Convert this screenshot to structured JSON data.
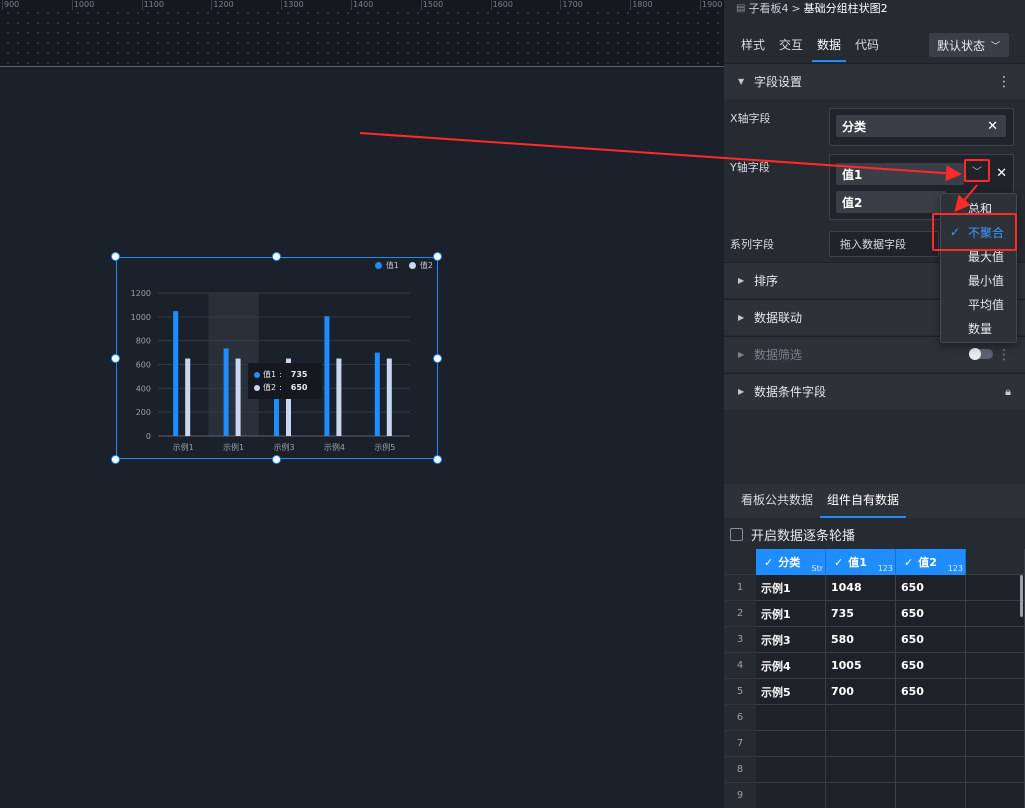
{
  "ruler": {
    "ticks": [
      "900",
      "1000",
      "1100",
      "1200",
      "1300",
      "1400",
      "1500",
      "1600",
      "1700",
      "1800",
      "1900"
    ]
  },
  "chart": {
    "legend": [
      {
        "name": "值1",
        "color": "#1f8cff"
      },
      {
        "name": "值2",
        "color": "#c9d8f0"
      }
    ],
    "tooltip": {
      "rows": [
        {
          "name": "值1",
          "value": "735",
          "color": "#1f8cff"
        },
        {
          "name": "值2",
          "value": "650",
          "color": "#c9d8f0"
        }
      ]
    }
  },
  "chart_data": {
    "type": "bar",
    "categories": [
      "示例1",
      "示例1",
      "示例3",
      "示例4",
      "示例5"
    ],
    "series": [
      {
        "name": "值1",
        "values": [
          1048,
          735,
          580,
          1005,
          700
        ],
        "color": "#1f8cff"
      },
      {
        "name": "值2",
        "values": [
          650,
          650,
          650,
          650,
          650
        ],
        "color": "#c9d8f0"
      }
    ],
    "ylim": [
      0,
      1200
    ],
    "yticks": [
      0,
      200,
      400,
      600,
      800,
      1000,
      1200
    ],
    "grid": true,
    "legend_position": "top-right",
    "highlighted_category_index": 1
  },
  "panel": {
    "breadcrumb": {
      "parent": "子看板4",
      "separator": ">",
      "current": "基础分组柱状图2"
    },
    "tabs": [
      "样式",
      "交互",
      "数据",
      "代码"
    ],
    "active_tab": "数据",
    "state_select": "默认状态",
    "field_section": {
      "title": "字段设置"
    },
    "x_field": {
      "label": "X轴字段",
      "value": "分类"
    },
    "y_field": {
      "label": "Y轴字段",
      "values": [
        "值1",
        "值2"
      ]
    },
    "series_field": {
      "label": "系列字段",
      "placeholder": "拖入数据字段"
    },
    "aggregate_menu": {
      "items": [
        "总和",
        "不聚合",
        "最大值",
        "最小值",
        "平均值",
        "数量"
      ],
      "selected": "不聚合"
    },
    "sections": [
      {
        "title": "排序",
        "dim": false
      },
      {
        "title": "数据联动",
        "dim": false
      },
      {
        "title": "数据筛选",
        "dim": true
      },
      {
        "title": "数据条件字段",
        "dim": false
      }
    ],
    "data_tabs": [
      "看板公共数据",
      "组件自有数据"
    ],
    "active_data_tab": "组件自有数据",
    "carousel_label": "开启数据逐条轮播",
    "table": {
      "columns": [
        {
          "name": "分类",
          "type": "Str"
        },
        {
          "name": "值1",
          "type": "123"
        },
        {
          "name": "值2",
          "type": "123"
        }
      ],
      "rows": [
        [
          "示例1",
          "1048",
          "650"
        ],
        [
          "示例1",
          "735",
          "650"
        ],
        [
          "示例3",
          "580",
          "650"
        ],
        [
          "示例4",
          "1005",
          "650"
        ],
        [
          "示例5",
          "700",
          "650"
        ],
        [
          "",
          "",
          ""
        ],
        [
          "",
          "",
          ""
        ],
        [
          "",
          "",
          ""
        ],
        [
          "",
          "",
          ""
        ]
      ],
      "row_numbers": [
        "1",
        "2",
        "3",
        "4",
        "5",
        "6",
        "7",
        "8",
        "9"
      ]
    }
  },
  "colors": {
    "accent": "#1f8cff",
    "annotation": "#ff2a2a",
    "panel_bg": "#262a31",
    "canvas_bg": "#1b212b"
  }
}
